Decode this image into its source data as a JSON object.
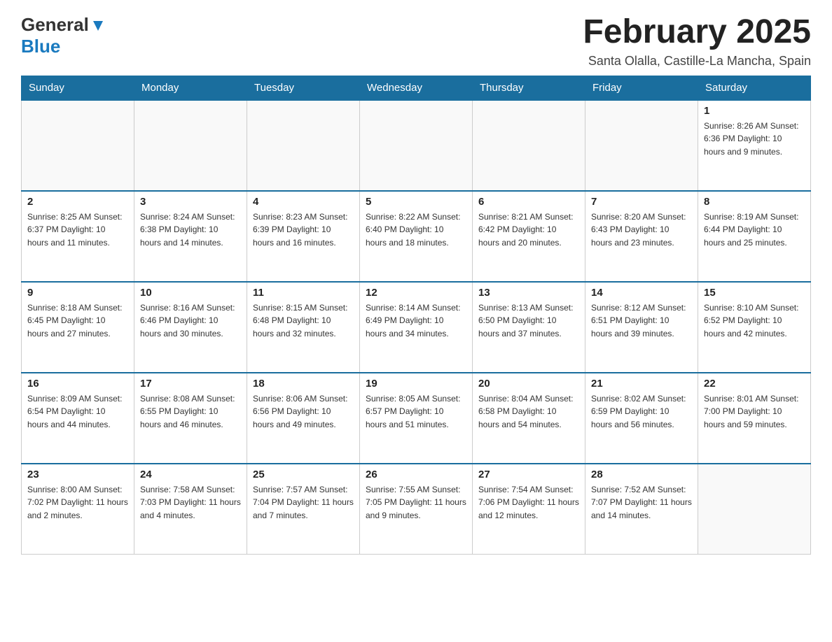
{
  "header": {
    "logo_general": "General",
    "logo_blue": "Blue",
    "month_title": "February 2025",
    "location": "Santa Olalla, Castille-La Mancha, Spain"
  },
  "days_of_week": [
    "Sunday",
    "Monday",
    "Tuesday",
    "Wednesday",
    "Thursday",
    "Friday",
    "Saturday"
  ],
  "weeks": [
    [
      {
        "day": "",
        "info": ""
      },
      {
        "day": "",
        "info": ""
      },
      {
        "day": "",
        "info": ""
      },
      {
        "day": "",
        "info": ""
      },
      {
        "day": "",
        "info": ""
      },
      {
        "day": "",
        "info": ""
      },
      {
        "day": "1",
        "info": "Sunrise: 8:26 AM\nSunset: 6:36 PM\nDaylight: 10 hours and 9 minutes."
      }
    ],
    [
      {
        "day": "2",
        "info": "Sunrise: 8:25 AM\nSunset: 6:37 PM\nDaylight: 10 hours and 11 minutes."
      },
      {
        "day": "3",
        "info": "Sunrise: 8:24 AM\nSunset: 6:38 PM\nDaylight: 10 hours and 14 minutes."
      },
      {
        "day": "4",
        "info": "Sunrise: 8:23 AM\nSunset: 6:39 PM\nDaylight: 10 hours and 16 minutes."
      },
      {
        "day": "5",
        "info": "Sunrise: 8:22 AM\nSunset: 6:40 PM\nDaylight: 10 hours and 18 minutes."
      },
      {
        "day": "6",
        "info": "Sunrise: 8:21 AM\nSunset: 6:42 PM\nDaylight: 10 hours and 20 minutes."
      },
      {
        "day": "7",
        "info": "Sunrise: 8:20 AM\nSunset: 6:43 PM\nDaylight: 10 hours and 23 minutes."
      },
      {
        "day": "8",
        "info": "Sunrise: 8:19 AM\nSunset: 6:44 PM\nDaylight: 10 hours and 25 minutes."
      }
    ],
    [
      {
        "day": "9",
        "info": "Sunrise: 8:18 AM\nSunset: 6:45 PM\nDaylight: 10 hours and 27 minutes."
      },
      {
        "day": "10",
        "info": "Sunrise: 8:16 AM\nSunset: 6:46 PM\nDaylight: 10 hours and 30 minutes."
      },
      {
        "day": "11",
        "info": "Sunrise: 8:15 AM\nSunset: 6:48 PM\nDaylight: 10 hours and 32 minutes."
      },
      {
        "day": "12",
        "info": "Sunrise: 8:14 AM\nSunset: 6:49 PM\nDaylight: 10 hours and 34 minutes."
      },
      {
        "day": "13",
        "info": "Sunrise: 8:13 AM\nSunset: 6:50 PM\nDaylight: 10 hours and 37 minutes."
      },
      {
        "day": "14",
        "info": "Sunrise: 8:12 AM\nSunset: 6:51 PM\nDaylight: 10 hours and 39 minutes."
      },
      {
        "day": "15",
        "info": "Sunrise: 8:10 AM\nSunset: 6:52 PM\nDaylight: 10 hours and 42 minutes."
      }
    ],
    [
      {
        "day": "16",
        "info": "Sunrise: 8:09 AM\nSunset: 6:54 PM\nDaylight: 10 hours and 44 minutes."
      },
      {
        "day": "17",
        "info": "Sunrise: 8:08 AM\nSunset: 6:55 PM\nDaylight: 10 hours and 46 minutes."
      },
      {
        "day": "18",
        "info": "Sunrise: 8:06 AM\nSunset: 6:56 PM\nDaylight: 10 hours and 49 minutes."
      },
      {
        "day": "19",
        "info": "Sunrise: 8:05 AM\nSunset: 6:57 PM\nDaylight: 10 hours and 51 minutes."
      },
      {
        "day": "20",
        "info": "Sunrise: 8:04 AM\nSunset: 6:58 PM\nDaylight: 10 hours and 54 minutes."
      },
      {
        "day": "21",
        "info": "Sunrise: 8:02 AM\nSunset: 6:59 PM\nDaylight: 10 hours and 56 minutes."
      },
      {
        "day": "22",
        "info": "Sunrise: 8:01 AM\nSunset: 7:00 PM\nDaylight: 10 hours and 59 minutes."
      }
    ],
    [
      {
        "day": "23",
        "info": "Sunrise: 8:00 AM\nSunset: 7:02 PM\nDaylight: 11 hours and 2 minutes."
      },
      {
        "day": "24",
        "info": "Sunrise: 7:58 AM\nSunset: 7:03 PM\nDaylight: 11 hours and 4 minutes."
      },
      {
        "day": "25",
        "info": "Sunrise: 7:57 AM\nSunset: 7:04 PM\nDaylight: 11 hours and 7 minutes."
      },
      {
        "day": "26",
        "info": "Sunrise: 7:55 AM\nSunset: 7:05 PM\nDaylight: 11 hours and 9 minutes."
      },
      {
        "day": "27",
        "info": "Sunrise: 7:54 AM\nSunset: 7:06 PM\nDaylight: 11 hours and 12 minutes."
      },
      {
        "day": "28",
        "info": "Sunrise: 7:52 AM\nSunset: 7:07 PM\nDaylight: 11 hours and 14 minutes."
      },
      {
        "day": "",
        "info": ""
      }
    ]
  ]
}
